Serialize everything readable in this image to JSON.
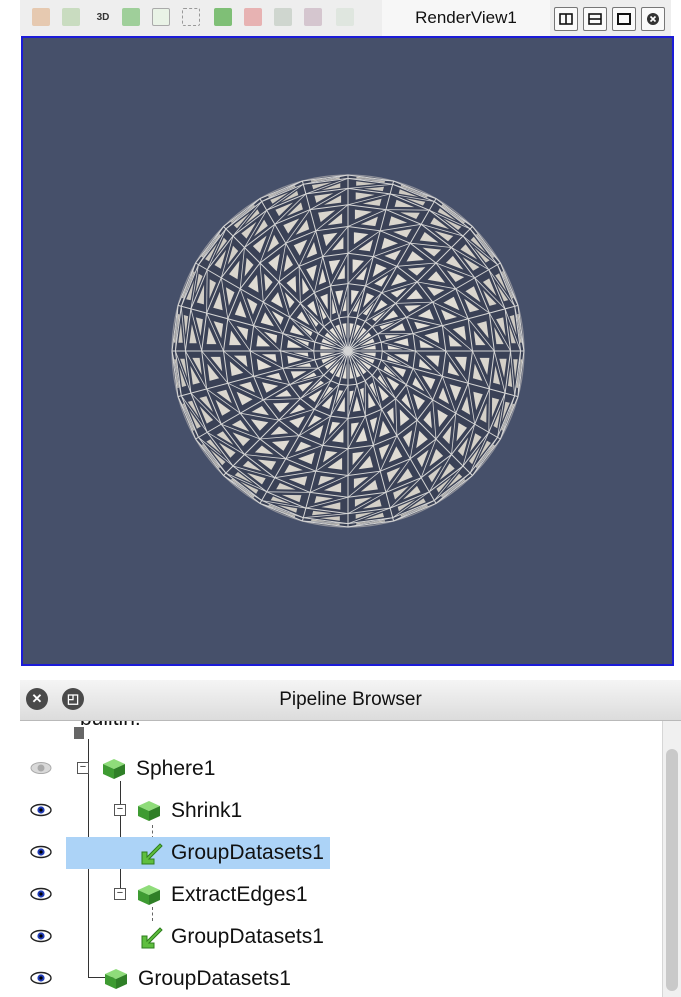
{
  "render_view": {
    "title": "RenderView1",
    "toolbar_icons": [
      "reset-camera-icon",
      "zoom-to-data-icon",
      "3d-toggle-icon",
      "camera-undo-icon",
      "select-cells-icon",
      "select-points-icon",
      "select-frustum-icon",
      "select-blocks-icon",
      "interactive-select-icon",
      "interactive-points-icon",
      "grow-selection-icon"
    ],
    "toolbar_3d_label": "3D",
    "view_buttons": [
      "split-horizontal-icon",
      "split-vertical-icon",
      "maximize-icon",
      "close-icon"
    ],
    "background_color": "#46506a",
    "active_border_color": "#1b1bd8"
  },
  "pipeline_browser": {
    "title": "Pipeline Browser",
    "root_label": "builtin:",
    "items": [
      {
        "label": "Sphere1",
        "visible": false,
        "icon": "source-cube-icon"
      },
      {
        "label": "Shrink1",
        "visible": true,
        "icon": "filter-cube-icon"
      },
      {
        "label": "GroupDatasets1",
        "visible": true,
        "icon": "group-arrow-icon",
        "selected": true
      },
      {
        "label": "ExtractEdges1",
        "visible": true,
        "icon": "filter-cube-icon"
      },
      {
        "label": "GroupDatasets1",
        "visible": true,
        "icon": "group-arrow-icon"
      },
      {
        "label": "GroupDatasets1",
        "visible": true,
        "icon": "filter-cube-icon"
      }
    ],
    "selection_color": "#acd3f7"
  }
}
